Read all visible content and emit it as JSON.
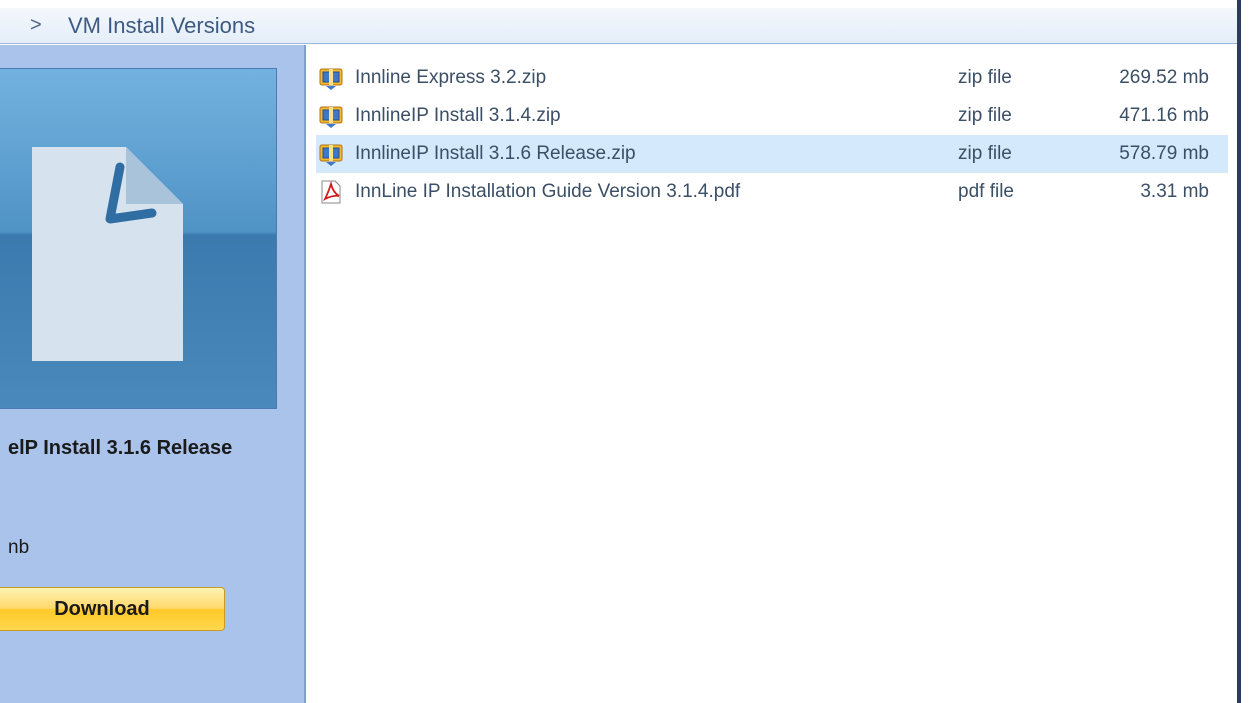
{
  "window": {
    "title_prefix": ">",
    "title": "VM Install Versions"
  },
  "preview": {
    "icon": "document-icon",
    "file_name": "elP Install 3.1.6 Release",
    "file_size": "nb",
    "download_label": "Download"
  },
  "files": [
    {
      "icon": "zip-archive-icon",
      "name": "Innline Express 3.2.zip",
      "type": "zip file",
      "size": "269.52 mb",
      "selected": false
    },
    {
      "icon": "zip-archive-icon",
      "name": "InnlineIP Install 3.1.4.zip",
      "type": "zip file",
      "size": "471.16 mb",
      "selected": false
    },
    {
      "icon": "zip-archive-icon",
      "name": "InnlineIP Install 3.1.6 Release.zip",
      "type": "zip file",
      "size": "578.79 mb",
      "selected": true
    },
    {
      "icon": "pdf-icon",
      "name": "InnLine IP Installation Guide Version 3.1.4.pdf",
      "type": "pdf file",
      "size": "3.31 mb",
      "selected": false
    }
  ],
  "colors": {
    "panel_bg": "#a9c3ea",
    "selected_row": "#d4e9fb",
    "button_gold": "#ffc929",
    "title_text": "#3d5a82"
  }
}
